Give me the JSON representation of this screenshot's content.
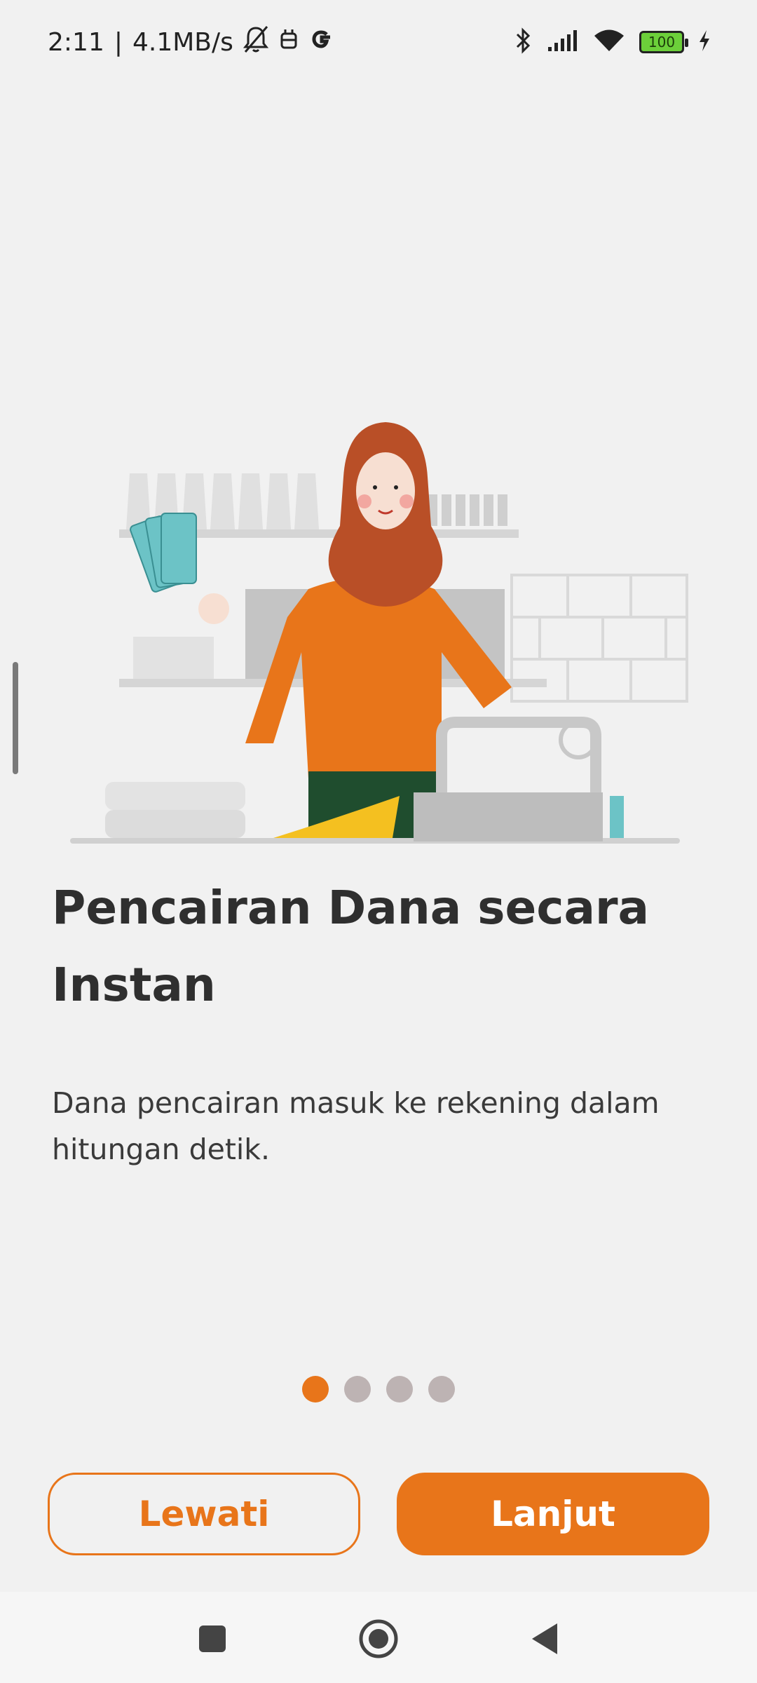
{
  "status_bar": {
    "time": "2:11",
    "speed": "4.1MB/s",
    "separator": "|",
    "battery_level": "100",
    "icons": [
      "bell-off-icon",
      "robot-icon",
      "google-icon",
      "bluetooth-icon",
      "signal-icon",
      "wifi-icon",
      "battery-icon",
      "charging-icon"
    ]
  },
  "onboarding": {
    "title": "Pencairan Dana secara Instan",
    "description": "Dana pencairan masuk ke rekening dalam hitungan detik.",
    "page_count": 4,
    "current_page": 1
  },
  "buttons": {
    "skip_label": "Lewati",
    "next_label": "Lanjut"
  },
  "colors": {
    "accent": "#e8751a",
    "background": "#f1f1f1",
    "dot_inactive": "#bdb3b3",
    "text": "#2f2f2f"
  },
  "nav_bar": {
    "icons": [
      "recents-square-icon",
      "home-circle-icon",
      "back-triangle-icon"
    ]
  }
}
